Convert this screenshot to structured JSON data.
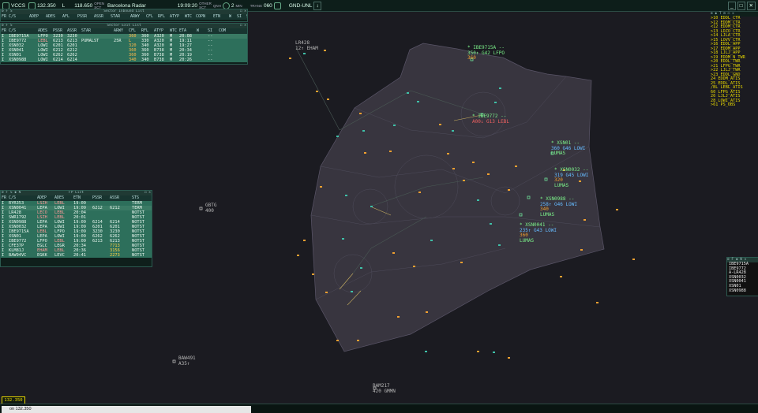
{
  "topbar": {
    "mode": "VCCS",
    "prim_freq": "132.350",
    "prim_l": "L",
    "sec_freq": "118.650",
    "prim_small": "OPEN",
    "sec_small": "SCT",
    "position": "Barcelona Radar",
    "time": "19:09:20",
    "ob_small_1": "OTHER",
    "ob_small_2": "SCT",
    "qnh_small": "QNH",
    "qnh_val": "2",
    "min_label": "MIN",
    "alt_small": "TRANS",
    "alt_val": "060",
    "filter": "GND-UNL"
  },
  "sector_inbound": {
    "title": "Sector Inbound List",
    "columns": [
      "FR",
      "C/S",
      "ADEP",
      "ADES",
      "AFL",
      "PSSR",
      "ASSR",
      "STAR",
      "ARWY",
      "CFL",
      "RFL",
      "ATYP",
      "WTC",
      "COPN",
      "ETN",
      "W",
      "SI",
      "SSR"
    ],
    "rows": []
  },
  "sector_exit": {
    "title": "Sector Exit List",
    "columns": [
      "FR",
      "C/S",
      "ADES",
      "PSSR",
      "ASSR",
      "STAR",
      "ARWY",
      "CFL",
      "RFL",
      "ATYP",
      "WTC",
      "ETA",
      "W",
      "SI",
      "COM"
    ],
    "rows": [
      [
        "I",
        "IBE9715A",
        "LFPO",
        "3230",
        "3230",
        "",
        "",
        "360",
        "360",
        "A320",
        "M",
        "20:08",
        "",
        "--",
        ""
      ],
      [
        "I",
        "IBE9772",
        "LEBL",
        "6213",
        "6213",
        "PUMALST",
        "25R",
        "L",
        "330",
        "A320",
        "M",
        "19:11",
        "",
        "--",
        ""
      ],
      [
        "I",
        "XSN032",
        "LOWI",
        "6201",
        "6201",
        "",
        "",
        "320",
        "340",
        "A320",
        "M",
        "19:27",
        "",
        "--",
        ""
      ],
      [
        "I",
        "XSN041",
        "LOWI",
        "6212",
        "6212",
        "",
        "",
        "360",
        "360",
        "B738",
        "M",
        "20:34",
        "",
        "--",
        ""
      ],
      [
        "I",
        "XSN01",
        "LOWI",
        "6262",
        "6262",
        "",
        "",
        "360",
        "360",
        "B738",
        "M",
        "20:19",
        "",
        "--",
        ""
      ],
      [
        "I",
        "XSN0988",
        "LOWI",
        "6214",
        "6214",
        "",
        "",
        "340",
        "340",
        "B738",
        "M",
        "20:26",
        "",
        "--",
        ""
      ]
    ]
  },
  "fp_list": {
    "title": "FP List",
    "columns": [
      "FR",
      "C/S",
      "ADEP",
      "ADES",
      "ETN",
      "PSSR",
      "ASSR",
      "STS"
    ],
    "rows": [
      [
        "I",
        "RYR353",
        "LSZH",
        "LEBL",
        "19:09",
        "",
        "",
        "TERM"
      ],
      [
        "I",
        "XSN0041",
        "LEPA",
        "LOWI",
        "19:09",
        "6212",
        "6212",
        "TERM"
      ],
      [
        "I",
        "LR428",
        "LECO",
        "LEBL",
        "20:04",
        "",
        "",
        "NOTST"
      ],
      [
        "I",
        "SWR1792",
        "LSZH",
        "LEBL",
        "20:01",
        "",
        "",
        "NOTST"
      ],
      [
        "I",
        "XSN0988",
        "LEPA",
        "LOWI",
        "19:09",
        "6214",
        "6214",
        "NOTST"
      ],
      [
        "I",
        "XSN0032",
        "LEPA",
        "LOWI",
        "19:09",
        "6201",
        "6201",
        "NOTST"
      ],
      [
        "I",
        "IBE9715A",
        "LEBL",
        "LFPO",
        "19:09",
        "3230",
        "3230",
        "NOTST"
      ],
      [
        "I",
        "XSN01",
        "LEPA",
        "LOWI",
        "19:09",
        "6262",
        "6262",
        "NOTST"
      ],
      [
        "I",
        "IBE9772",
        "LFPO",
        "LEBL",
        "19:09",
        "6213",
        "6213",
        "NOTST"
      ],
      [
        "I",
        "CFE37P",
        "EGLC",
        "LEGR",
        "20:34",
        "",
        "7713",
        "NOTST"
      ],
      [
        "I",
        "KLM81J",
        "EHAM",
        "LEBL",
        "20:36",
        "",
        "3156",
        "NOTST"
      ],
      [
        "I",
        "BAW94VC",
        "EGKK",
        "LEVC",
        "20:41",
        "",
        "2273",
        "NOTST"
      ]
    ]
  },
  "stations": {
    "title": "ATC",
    "items": [
      ">10 EDDL_CTR",
      ">12 EDDM_CTR",
      "<12 EDDM_CTR",
      ">13 LDZO_CTR",
      ">14 LJLA_CTR",
      ">15 LOVV_CTR",
      ">16 EDDL_APP",
      ">17 EDDM_APP",
      ">18 LJLJ_APP",
      ">19 EDDM_N_TWR",
      ">20 EDDL_TWR",
      ">21 LFPG_TWR",
      ">22 LJLJ_TWR",
      ">23 EDDL_GND",
      " 24 EDDM_ATIS",
      " 25 EDDL_ATIS",
      "/BL LEBL_ATIS",
      " 60 LFPG_ATIS",
      " 26 LJLJ_ATIS",
      " 28 LOWI_ATIS",
      ">61 PS_OBS"
    ]
  },
  "cs_list": {
    "title": "CS",
    "items": [
      "IBE9715A",
      "IBE9772",
      "A-LR428",
      "XSN0032",
      "XSN0041",
      "XSN01",
      "XSN0988"
    ]
  },
  "aircraft": [
    {
      "cs": "* IBE9715A --",
      "l2": "350↑ G42 LFPO",
      "l3": "360"
    },
    {
      "cs": "* IBE9772 --",
      "l2": "A00↓ G13 LEBL",
      "l3": ""
    },
    {
      "cs": "* XSN01 --",
      "l2": "360 G46 LOWI",
      "l3": "LUMAS"
    },
    {
      "cs": "* XSN0032 --",
      "l2": "319 G45 LOWI",
      "l3": "320"
    },
    {
      "cs": "* XSN0988 --",
      "l2": "258↑ G46 LOWI",
      "l3": "340"
    },
    {
      "cs": "* XSN0041 --",
      "l2": "235↑ G43 LOWI",
      "l3": "360"
    }
  ],
  "other_traffic": [
    {
      "cs": "LR428",
      "l2": "12↑ EHAM"
    },
    {
      "cs": "GBTG",
      "l2": "400"
    },
    {
      "cs": "BAW491",
      "l2": "A35↑"
    },
    {
      "cs": "BAM217",
      "l2": "420 GMMN"
    }
  ],
  "extras": {
    "lumas_a": "LUMAS",
    "lumas_b": "LUMAS",
    "lumas_c": "LUMAS"
  },
  "command": {
    "freq_box": "132.350",
    "text": "on 132.350"
  },
  "colors": {
    "panel": "#0f1f1b",
    "selected_row": "#3a7a64",
    "assumed": "#7cf28a",
    "concerned": "#f0a030",
    "station": "#e8d800",
    "sector": "#38353f"
  }
}
